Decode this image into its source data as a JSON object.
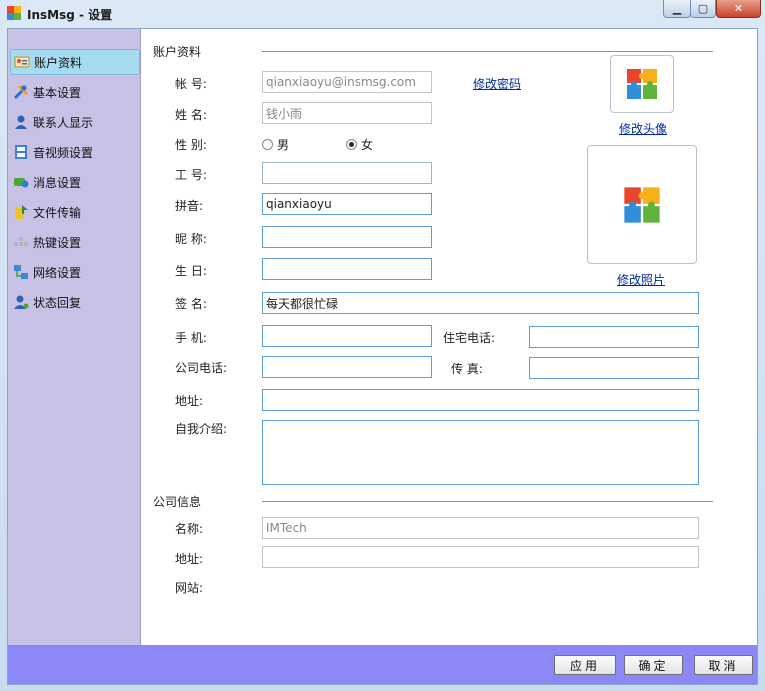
{
  "window": {
    "title": "InsMsg - 设置",
    "controls": [
      "minimize-icon",
      "maximize-icon",
      "close-icon"
    ]
  },
  "sidebar": {
    "items": [
      {
        "label": "账户资料",
        "icon": "id-card-icon",
        "active": true
      },
      {
        "label": "基本设置",
        "icon": "tools-icon"
      },
      {
        "label": "联系人显示",
        "icon": "user-icon"
      },
      {
        "label": "音视频设置",
        "icon": "film-icon"
      },
      {
        "label": "消息设置",
        "icon": "message-icon"
      },
      {
        "label": "文件传输",
        "icon": "file-transfer-icon"
      },
      {
        "label": "热键设置",
        "icon": "keyboard-icon"
      },
      {
        "label": "网络设置",
        "icon": "network-icon"
      },
      {
        "label": "状态回复",
        "icon": "user-status-icon"
      }
    ]
  },
  "account": {
    "section_title": "账户资料",
    "account_label": "帐 号:",
    "account_value": "qianxiaoyu@insmsg.com",
    "change_password": "修改密码",
    "name_label": "姓 名:",
    "name_value": "钱小雨",
    "gender_label": "性 别:",
    "gender_male": "男",
    "gender_female": "女",
    "gender_selected": "女",
    "employee_id_label": "工 号:",
    "employee_id_value": "",
    "pinyin_label": "拼音:",
    "pinyin_value": "qianxiaoyu",
    "nickname_label": "昵 称:",
    "nickname_value": "",
    "birthday_label": "生 日:",
    "birthday_value": "",
    "signature_label": "签 名:",
    "signature_value": "每天都很忙碌",
    "mobile_label": "手 机:",
    "mobile_value": "",
    "home_phone_label": "住宅电话:",
    "home_phone_value": "",
    "office_phone_label": "公司电话:",
    "office_phone_value": "",
    "fax_label": "传 真:",
    "fax_value": "",
    "address_label": "地址:",
    "address_value": "",
    "intro_label": "自我介绍:",
    "intro_value": "",
    "change_avatar": "修改头像",
    "change_photo": "修改照片"
  },
  "company": {
    "section_title": "公司信息",
    "name_label": "名称:",
    "name_value": "IMTech",
    "address_label": "地址:",
    "address_value": "",
    "website_label": "网站:"
  },
  "footer": {
    "apply": "应用",
    "ok": "确定",
    "cancel": "取消"
  },
  "colors": {
    "sidebar_bg": "#c7c1e6",
    "active_item": "#a7dcf0",
    "footer_bg": "#8b87f6",
    "link": "#00299b"
  }
}
